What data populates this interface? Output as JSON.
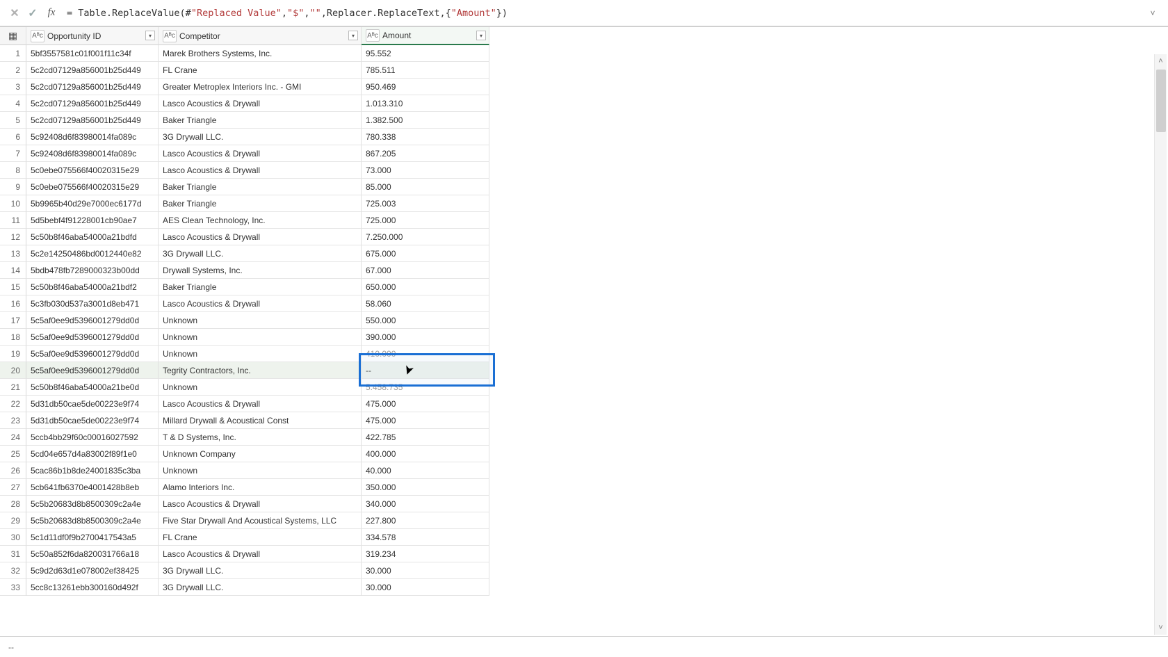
{
  "formula_bar": {
    "fx_label": "fx",
    "cancel_symbol": "✕",
    "accept_symbol": "✓",
    "expand_symbol": "˅",
    "text_prefix": "= Table.ReplaceValue(#",
    "text_str1": "\"Replaced Value\"",
    "text_mid1": ",",
    "text_str2": "\"$\"",
    "text_mid2": ",",
    "text_str3": "\"\"",
    "text_mid3": ",Replacer.ReplaceText,{",
    "text_str4": "\"Amount\"",
    "text_suffix": "})"
  },
  "columns": {
    "index_icon_label": "▦",
    "type_icon_label": "Aᴮc",
    "dd_symbol": "▾",
    "opportunity": "Opportunity ID",
    "competitor": "Competitor",
    "amount": "Amount"
  },
  "rows": [
    {
      "n": "1",
      "opp": "5bf3557581c01f001f11c34f",
      "comp": "Marek Brothers Systems, Inc.",
      "amt": "95.552"
    },
    {
      "n": "2",
      "opp": "5c2cd07129a856001b25d449",
      "comp": "FL Crane",
      "amt": "785.511"
    },
    {
      "n": "3",
      "opp": "5c2cd07129a856001b25d449",
      "comp": "Greater Metroplex Interiors  Inc. - GMI",
      "amt": "950.469"
    },
    {
      "n": "4",
      "opp": "5c2cd07129a856001b25d449",
      "comp": "Lasco Acoustics & Drywall",
      "amt": "1.013.310"
    },
    {
      "n": "5",
      "opp": "5c2cd07129a856001b25d449",
      "comp": "Baker Triangle",
      "amt": "1.382.500"
    },
    {
      "n": "6",
      "opp": "5c92408d6f83980014fa089c",
      "comp": "3G Drywall LLC.",
      "amt": "780.338"
    },
    {
      "n": "7",
      "opp": "5c92408d6f83980014fa089c",
      "comp": "Lasco Acoustics & Drywall",
      "amt": "867.205"
    },
    {
      "n": "8",
      "opp": "5c0ebe075566f40020315e29",
      "comp": "Lasco Acoustics & Drywall",
      "amt": "73.000"
    },
    {
      "n": "9",
      "opp": "5c0ebe075566f40020315e29",
      "comp": "Baker Triangle",
      "amt": "85.000"
    },
    {
      "n": "10",
      "opp": "5b9965b40d29e7000ec6177d",
      "comp": "Baker Triangle",
      "amt": "725.003"
    },
    {
      "n": "11",
      "opp": "5d5bebf4f91228001cb90ae7",
      "comp": "AES Clean Technology, Inc.",
      "amt": "725.000"
    },
    {
      "n": "12",
      "opp": "5c50b8f46aba54000a21bdfd",
      "comp": "Lasco Acoustics & Drywall",
      "amt": "7.250.000"
    },
    {
      "n": "13",
      "opp": "5c2e14250486bd0012440e82",
      "comp": "3G Drywall LLC.",
      "amt": "675.000"
    },
    {
      "n": "14",
      "opp": "5bdb478fb7289000323b00dd",
      "comp": "Drywall Systems, Inc.",
      "amt": "67.000"
    },
    {
      "n": "15",
      "opp": "5c50b8f46aba54000a21bdf2",
      "comp": "Baker Triangle",
      "amt": "650.000"
    },
    {
      "n": "16",
      "opp": "5c3fb030d537a3001d8eb471",
      "comp": "Lasco Acoustics & Drywall",
      "amt": "58.060"
    },
    {
      "n": "17",
      "opp": "5c5af0ee9d5396001279dd0d",
      "comp": "Unknown",
      "amt": "550.000"
    },
    {
      "n": "18",
      "opp": "5c5af0ee9d5396001279dd0d",
      "comp": "Unknown",
      "amt": "390.000"
    },
    {
      "n": "19",
      "opp": "5c5af0ee9d5396001279dd0d",
      "comp": "Unknown",
      "amt": "410.000"
    },
    {
      "n": "20",
      "opp": "5c5af0ee9d5396001279dd0d",
      "comp": "Tegrity Contractors, Inc.",
      "amt": "--"
    },
    {
      "n": "21",
      "opp": "5c50b8f46aba54000a21be0d",
      "comp": "Unknown",
      "amt": "5.458.735"
    },
    {
      "n": "22",
      "opp": "5d31db50cae5de00223e9f74",
      "comp": "Lasco Acoustics & Drywall",
      "amt": "475.000"
    },
    {
      "n": "23",
      "opp": "5d31db50cae5de00223e9f74",
      "comp": "Millard Drywall & Acoustical Const",
      "amt": "475.000"
    },
    {
      "n": "24",
      "opp": "5ccb4bb29f60c00016027592",
      "comp": "T & D Systems, Inc.",
      "amt": "422.785"
    },
    {
      "n": "25",
      "opp": "5cd04e657d4a83002f89f1e0",
      "comp": "Unknown Company",
      "amt": "400.000"
    },
    {
      "n": "26",
      "opp": "5cac86b1b8de24001835c3ba",
      "comp": "Unknown",
      "amt": "40.000"
    },
    {
      "n": "27",
      "opp": "5cb641fb6370e4001428b8eb",
      "comp": "Alamo Interiors Inc.",
      "amt": "350.000"
    },
    {
      "n": "28",
      "opp": "5c5b20683d8b8500309c2a4e",
      "comp": "Lasco Acoustics & Drywall",
      "amt": "340.000"
    },
    {
      "n": "29",
      "opp": "5c5b20683d8b8500309c2a4e",
      "comp": "Five Star Drywall And Acoustical Systems, LLC",
      "amt": "227.800"
    },
    {
      "n": "30",
      "opp": "5c1d11df0f9b2700417543a5",
      "comp": "FL Crane",
      "amt": "334.578"
    },
    {
      "n": "31",
      "opp": "5c50a852f6da820031766a18",
      "comp": "Lasco Acoustics & Drywall",
      "amt": "319.234"
    },
    {
      "n": "32",
      "opp": "5c9d2d63d1e078002ef38425",
      "comp": "3G Drywall LLC.",
      "amt": "30.000"
    },
    {
      "n": "33",
      "opp": "5cc8c13261ebb300160d492f",
      "comp": "3G Drywall LLC.",
      "amt": "30.000"
    }
  ],
  "selected_row_index": 19,
  "status_bar_text": "--",
  "scroll_arrow_up": "˄",
  "scroll_arrow_down": "˅"
}
